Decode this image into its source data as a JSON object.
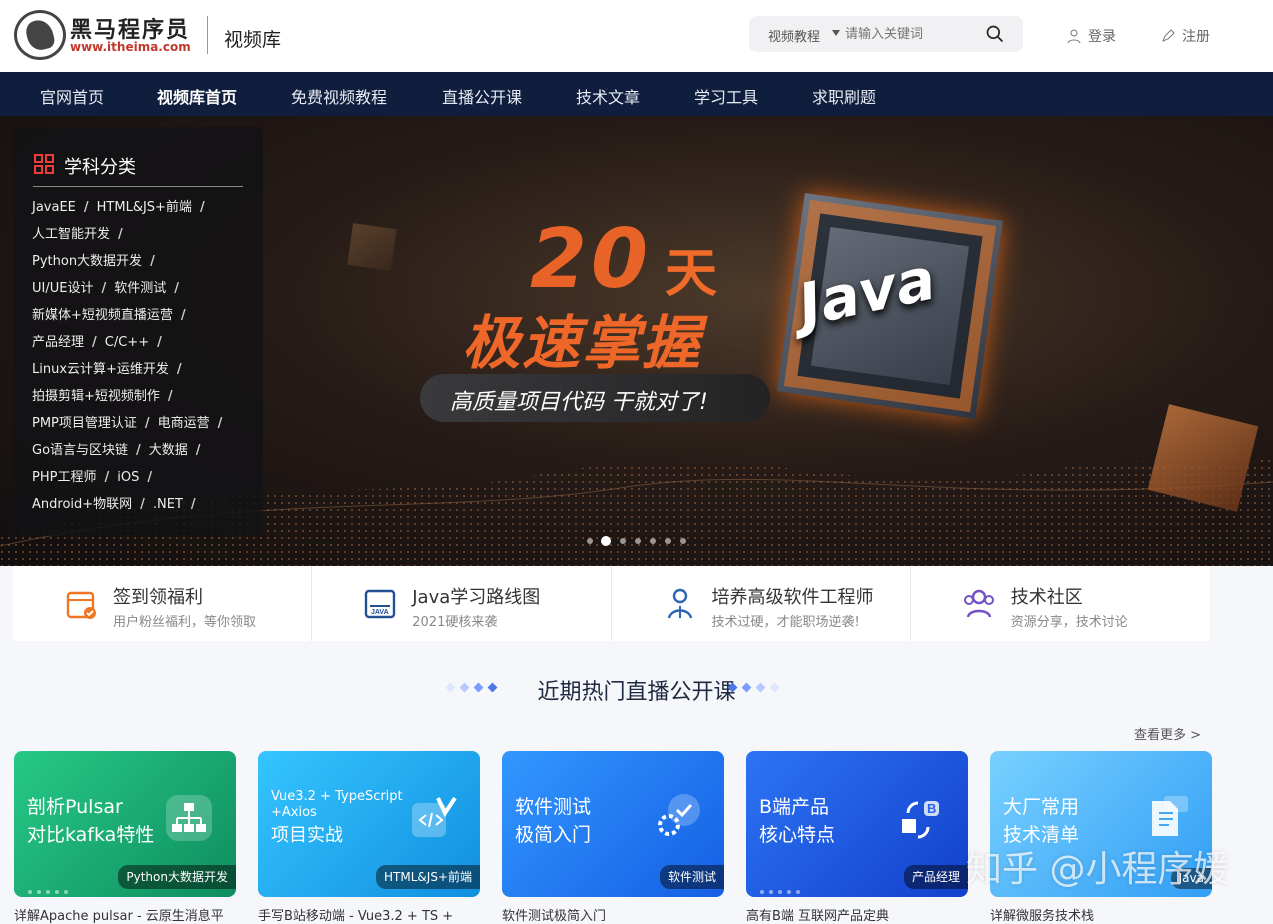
{
  "header": {
    "logo_text": "黑马程序员",
    "logo_url": "www.itheima.com",
    "site_sub": "视频库",
    "search": {
      "category": "视频教程",
      "placeholder": "请输入关键词"
    },
    "login": "登录",
    "register": "注册"
  },
  "nav": {
    "items": [
      {
        "label": "官网首页",
        "active": false
      },
      {
        "label": "视频库首页",
        "active": true
      },
      {
        "label": "免费视频教程",
        "active": false
      },
      {
        "label": "直播公开课",
        "active": false
      },
      {
        "label": "技术文章",
        "active": false
      },
      {
        "label": "学习工具",
        "active": false
      },
      {
        "label": "求职刷题",
        "active": false
      }
    ]
  },
  "sidebar": {
    "title": "学科分类",
    "rows": [
      [
        "JavaEE",
        "HTML&JS+前端"
      ],
      [
        "人工智能开发"
      ],
      [
        "Python大数据开发"
      ],
      [
        "UI/UE设计",
        "软件测试"
      ],
      [
        "新媒体+短视频直播运营"
      ],
      [
        "产品经理",
        "C/C++"
      ],
      [
        "Linux云计算+运维开发"
      ],
      [
        "拍摄剪辑+短视频制作"
      ],
      [
        "PMP项目管理认证",
        "电商运营"
      ],
      [
        "Go语言与区块链",
        "大数据"
      ],
      [
        "PHP工程师",
        "iOS"
      ],
      [
        "Android+物联网",
        ".NET"
      ]
    ]
  },
  "banner": {
    "number": "20",
    "day": "天",
    "title": "极速掌握",
    "java": "Java",
    "tagline": "高质量项目代码 干就对了!",
    "active_dot": 1,
    "dot_count": 7
  },
  "quick_links": [
    {
      "title": "签到领福利",
      "sub": "用户粉丝福利，等你领取",
      "icon": "calendar-check-icon",
      "color": "#ef7622"
    },
    {
      "title": "Java学习路线图",
      "sub": "2021硬核来袭",
      "icon": "java-board-icon",
      "color": "#244f92"
    },
    {
      "title": "培养高级软件工程师",
      "sub": "技术过硬，才能职场逆袭!",
      "icon": "engineer-icon",
      "color": "#2e65b4"
    },
    {
      "title": "技术社区",
      "sub": "资源分享，技术讨论",
      "icon": "community-icon",
      "color": "#7551c6"
    }
  ],
  "section": {
    "title": "近期热门直播公开课",
    "more": "查看更多 >"
  },
  "courses": [
    {
      "line1": "剖析Pulsar",
      "line2": "对比kafka特性",
      "tag": "Python大数据开发",
      "bg1": "#20c180",
      "bg2": "#11915e",
      "icon": "network-icon",
      "note": "详解Apache pulsar - 云原生消息平"
    },
    {
      "line1": "Vue3.2 + TypeScript",
      "line2": "+Axios",
      "line3": "项目实战",
      "tag": "HTML&JS+前端",
      "bg1": "#26b4f4",
      "bg2": "#1496dc",
      "icon": "code-icon",
      "note": "手写B站移动端 - Vue3.2 + TS +"
    },
    {
      "line1": "软件测试",
      "line2": "极简入门",
      "tag": "软件测试",
      "bg1": "#2e8eff",
      "bg2": "#1867e8",
      "icon": "gear-check-icon",
      "note": "软件测试极简入门"
    },
    {
      "line1": "B端产品",
      "line2": "核心特点",
      "tag": "产品经理",
      "bg1": "#2b6ff0",
      "bg2": "#1446ce",
      "icon": "b-product-icon",
      "note": "高有B端 互联网产品定典"
    },
    {
      "line1": "大厂常用",
      "line2": "技术清单",
      "tag": "Java",
      "bg1": "#6ec8ff",
      "bg2": "#2f9ef5",
      "icon": "document-code-icon",
      "note": "详解微服务技术栈"
    }
  ],
  "watermark": "知乎 @小程序媛"
}
